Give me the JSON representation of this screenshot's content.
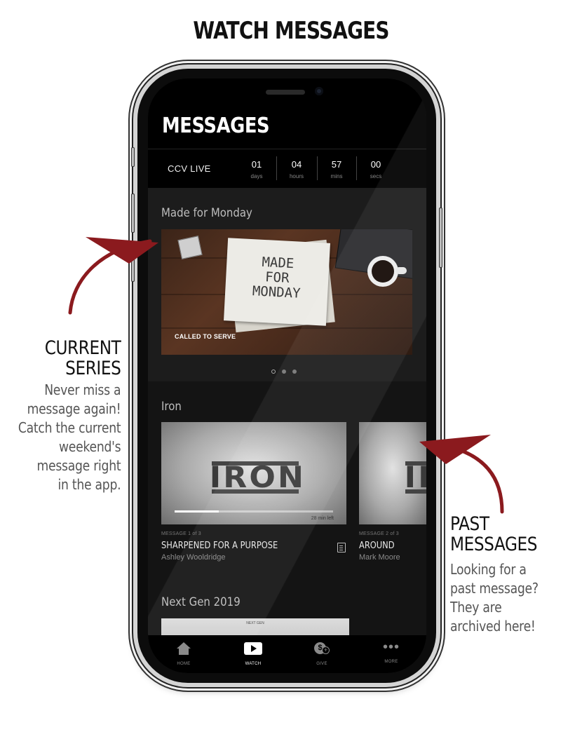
{
  "page": {
    "title": "WATCH MESSAGES"
  },
  "app": {
    "title": "MESSAGES",
    "live": {
      "label": "CCV LIVE",
      "countdown": [
        {
          "value": "01",
          "unit": "days"
        },
        {
          "value": "04",
          "unit": "hours"
        },
        {
          "value": "57",
          "unit": "mins"
        },
        {
          "value": "00",
          "unit": "secs"
        }
      ]
    },
    "current_series": {
      "title": "Made for Monday",
      "artwork_text": "MADE\nFOR\nMONDAY",
      "caption": "CALLED TO SERVE",
      "carousel_pages": 3,
      "carousel_active": 1
    },
    "past_series": {
      "title": "Iron",
      "messages": [
        {
          "thumb_text": "IRON",
          "meta": "MESSAGE 1 of 3",
          "title": "SHARPENED FOR A PURPOSE",
          "author": "Ashley Wooldridge",
          "progress_text": "28 min left",
          "progress": 0.28,
          "has_notes": true
        },
        {
          "thumb_text": "IR",
          "meta": "MESSAGE 2 of 3",
          "title": "AROUND",
          "author": "Mark Moore"
        }
      ]
    },
    "next_series": {
      "title": "Next Gen 2019",
      "thumb_text": "NEXT GEN"
    },
    "tabs": [
      {
        "label": "HOME",
        "icon": "home-icon"
      },
      {
        "label": "WATCH",
        "icon": "play-icon",
        "active": true
      },
      {
        "label": "GIVE",
        "icon": "give-icon"
      },
      {
        "label": "MORE",
        "icon": "more-icon"
      }
    ]
  },
  "annotations": {
    "current": {
      "heading_line1": "CURRENT",
      "heading_line2": "SERIES",
      "body": [
        "Never miss a",
        "message again!",
        "Catch the current",
        "weekend's",
        "message right",
        "in the app."
      ]
    },
    "past": {
      "heading_line1": "PAST",
      "heading_line2": "MESSAGES",
      "body": [
        "Looking for a",
        "past message?",
        "They are",
        "archived here!"
      ]
    },
    "arrow_color": "#8b1a1e"
  }
}
